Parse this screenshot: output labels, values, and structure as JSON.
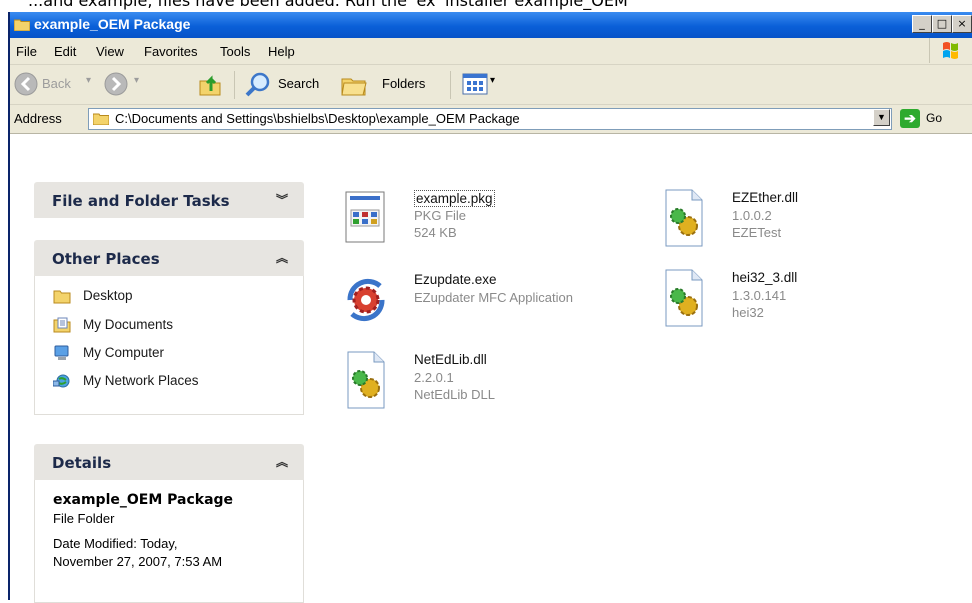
{
  "window": {
    "title": "example_OEM Package",
    "top_strip_text": "...and example, files have been added. Run the 'ex' installer example_OEM"
  },
  "menu": [
    "File",
    "Edit",
    "View",
    "Favorites",
    "Tools",
    "Help"
  ],
  "toolbar": {
    "back": "Back",
    "search": "Search",
    "folders": "Folders"
  },
  "address": {
    "label": "Address",
    "value": "C:\\Documents and Settings\\bshielbs\\Desktop\\example_OEM Package",
    "go": "Go"
  },
  "tasks": {
    "file_folder_tasks": "File and Folder Tasks",
    "other_places": {
      "title": "Other Places",
      "items": [
        {
          "label": "Desktop",
          "icon": "folder-icon"
        },
        {
          "label": "My Documents",
          "icon": "my-documents-icon"
        },
        {
          "label": "My Computer",
          "icon": "my-computer-icon"
        },
        {
          "label": "My Network Places",
          "icon": "network-places-icon"
        }
      ]
    },
    "details": {
      "title": "Details",
      "name": "example_OEM Package",
      "type": "File Folder",
      "modified_line1": "Date Modified: Today,",
      "modified_line2": "November 27, 2007, 7:53 AM"
    }
  },
  "files": [
    {
      "name": "example.pkg",
      "line2": "PKG File",
      "line3": "524 KB",
      "icon": "pkg-file-icon"
    },
    {
      "name": "EZEther.dll",
      "line2": "1.0.0.2",
      "line3": "EZETest",
      "icon": "dll-icon"
    },
    {
      "name": "Ezupdate.exe",
      "line2": "EZupdater MFC Application",
      "line3": "",
      "icon": "exe-gear-icon"
    },
    {
      "name": "hei32_3.dll",
      "line2": "1.3.0.141",
      "line3": "hei32",
      "icon": "dll-icon"
    },
    {
      "name": "NetEdLib.dll",
      "line2": "2.2.0.1",
      "line3": "NetEdLib DLL",
      "icon": "dll-icon"
    }
  ],
  "colors": {
    "titlebar": "#0a5fd8",
    "chrome": "#ece9d8",
    "panel_header": "#e7e5e1",
    "subtext": "#8a8a8a"
  }
}
